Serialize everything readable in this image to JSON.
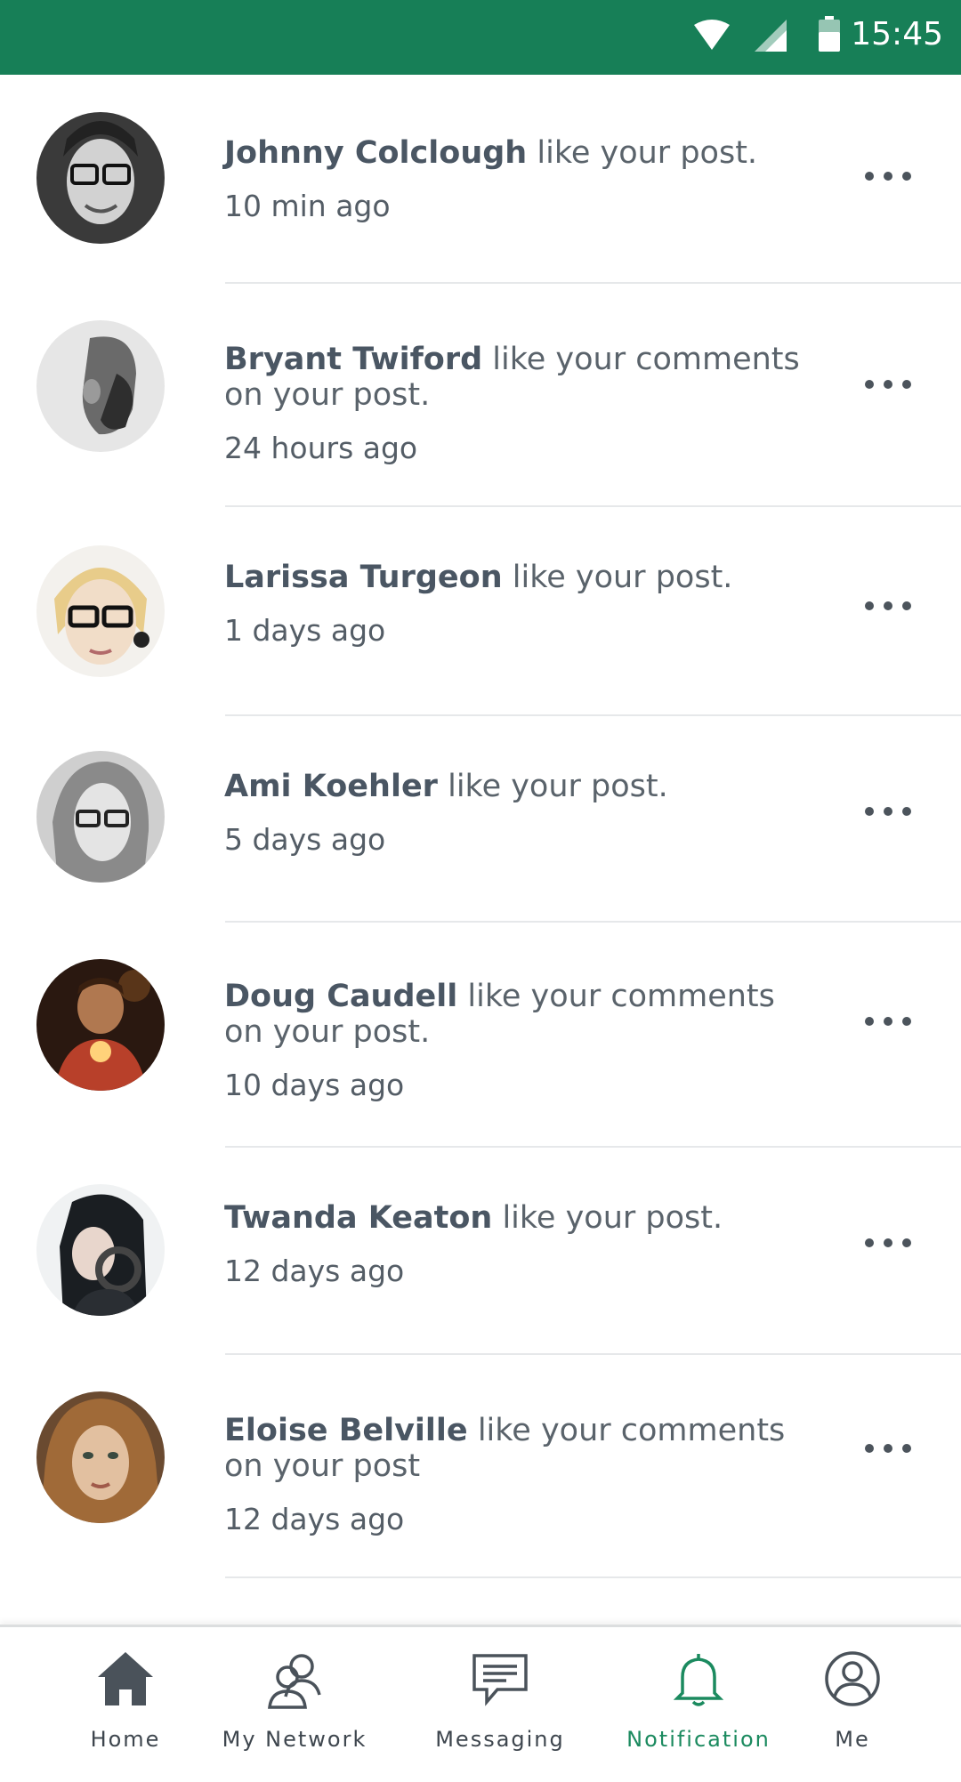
{
  "status_bar": {
    "time": "15:45",
    "background": "#177f57"
  },
  "notifications": [
    {
      "name": "Johnny Colclough",
      "action": "like your post.",
      "time": "10 min ago"
    },
    {
      "name": "Bryant Twiford",
      "action": "like your comments on your post.",
      "time": "24 hours ago"
    },
    {
      "name": "Larissa Turgeon",
      "action": "like your post.",
      "time": "1 days ago"
    },
    {
      "name": "Ami Koehler",
      "action": "like your post.",
      "time": "5 days ago"
    },
    {
      "name": "Doug Caudell",
      "action": "like your comments on your post.",
      "time": "10 days ago"
    },
    {
      "name": "Twanda Keaton",
      "action": "like your post.",
      "time": "12 days ago"
    },
    {
      "name": "Eloise Belville",
      "action": "like your comments on your post",
      "time": "12 days ago"
    }
  ],
  "tabbar": {
    "home": "Home",
    "network": "My Network",
    "messaging": "Messaging",
    "notification": "Notification",
    "me": "Me",
    "active_color": "#1b8a5f"
  }
}
